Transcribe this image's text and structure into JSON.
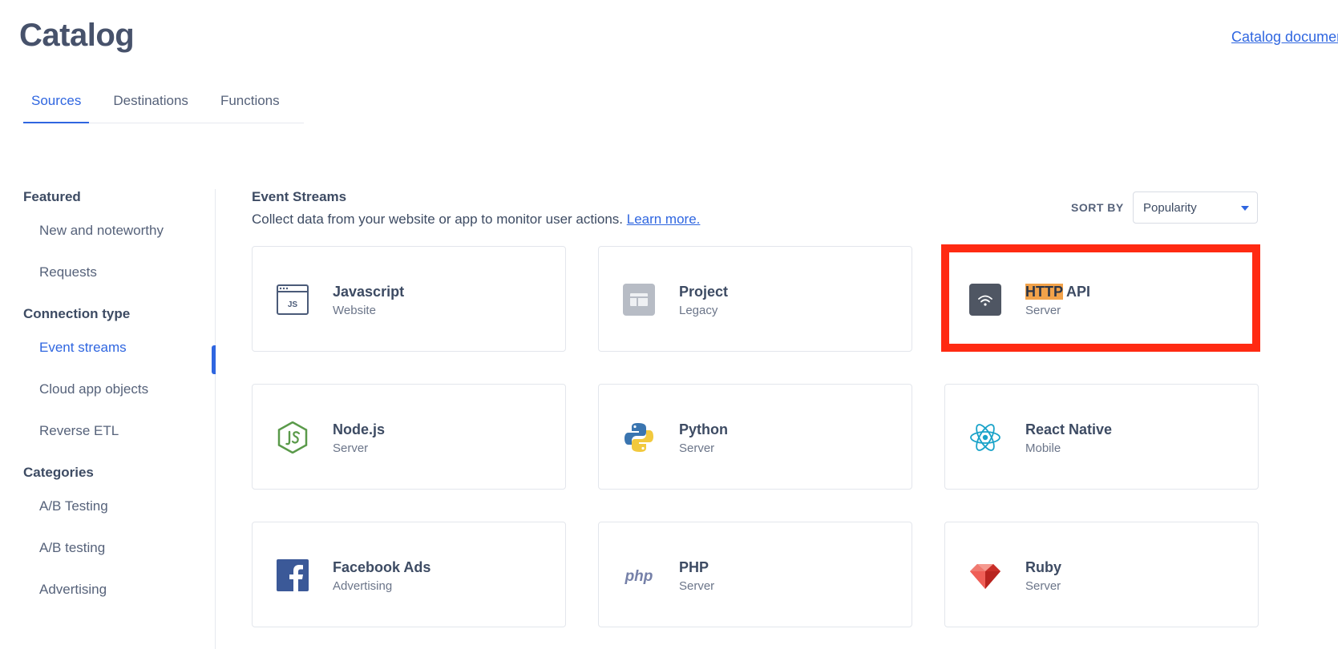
{
  "header": {
    "title": "Catalog",
    "doc_link": "Catalog documentation"
  },
  "tabs": [
    {
      "label": "Sources",
      "active": true
    },
    {
      "label": "Destinations",
      "active": false
    },
    {
      "label": "Functions",
      "active": false
    }
  ],
  "sidebar": {
    "groups": [
      {
        "heading": "Featured",
        "items": [
          "New and noteworthy",
          "Requests"
        ]
      },
      {
        "heading": "Connection type",
        "items": [
          "Event streams",
          "Cloud app objects",
          "Reverse ETL"
        ]
      },
      {
        "heading": "Categories",
        "items": [
          "A/B Testing",
          "A/B testing",
          "Advertising"
        ]
      }
    ],
    "active_item": "Event streams"
  },
  "section": {
    "title": "Event Streams",
    "description": "Collect data from your website or app to monitor user actions.",
    "learn_more": "Learn more."
  },
  "sort": {
    "label": "SORT BY",
    "value": "Popularity"
  },
  "cards": [
    {
      "name": "Javascript",
      "type": "Website",
      "icon": "javascript-icon"
    },
    {
      "name": "Project",
      "type": "Legacy",
      "icon": "project-icon"
    },
    {
      "name_highlight": "HTTP",
      "name": " API",
      "type": "Server",
      "icon": "wifi-icon"
    },
    {
      "name": "Node.js",
      "type": "Server",
      "icon": "nodejs-icon"
    },
    {
      "name": "Python",
      "type": "Server",
      "icon": "python-icon"
    },
    {
      "name": "React Native",
      "type": "Mobile",
      "icon": "react-icon"
    },
    {
      "name": "Facebook Ads",
      "type": "Advertising",
      "icon": "facebook-icon"
    },
    {
      "name": "PHP",
      "type": "Server",
      "icon": "php-icon"
    },
    {
      "name": "Ruby",
      "type": "Server",
      "icon": "ruby-icon"
    }
  ],
  "icon_labels": {
    "javascript": "JS",
    "php": "php"
  },
  "colors": {
    "accent": "#2f66e0",
    "highlight_box": "#ff2a12",
    "search_highlight": "#f2a24a"
  }
}
